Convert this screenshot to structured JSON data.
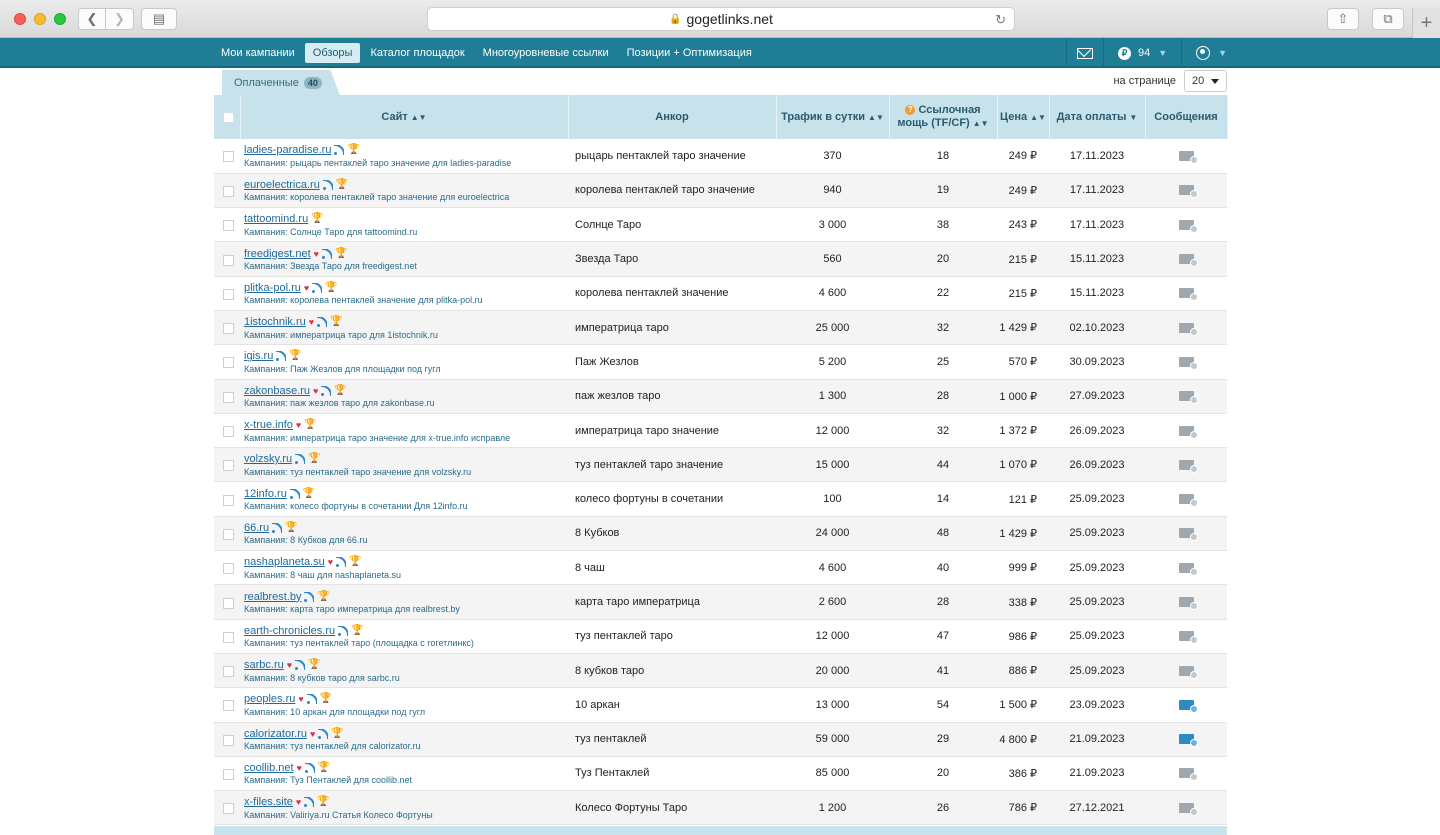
{
  "browser": {
    "url": "gogetlinks.net"
  },
  "nav": {
    "items": [
      "Мои кампании",
      "Обзоры",
      "Каталог площадок",
      "Многоуровневые ссылки",
      "Позиции + Оптимизация"
    ],
    "active_index": 1,
    "balance": "94",
    "currency_symbol": "₽"
  },
  "tabs": {
    "paid_label": "Оплаченные",
    "paid_count": "40"
  },
  "per_page": {
    "label": "на странице",
    "value": "20"
  },
  "table": {
    "headers": {
      "site": "Сайт",
      "anchor": "Анкор",
      "traffic": "Трафик в сутки",
      "power_line1": "Ссылочная",
      "power_line2": "мощь (TF/CF)",
      "price": "Цена",
      "date": "Дата оплаты",
      "messages": "Сообщения"
    },
    "rows": [
      {
        "site": "ladies-paradise.ru",
        "heart": false,
        "campaign": "Кампания: рыцарь пентаклей таро значение для ladies-paradise",
        "anchor": "рыцарь пентаклей таро значение",
        "traffic": "370",
        "power": "18",
        "price": "249 ₽",
        "date": "17.11.2023",
        "new_msg": false
      },
      {
        "site": "euroelectrica.ru",
        "heart": false,
        "campaign": "Кампания: королева пентаклей таро значение для euroelectrica",
        "anchor": "королева пентаклей таро значение",
        "traffic": "940",
        "power": "19",
        "price": "249 ₽",
        "date": "17.11.2023",
        "new_msg": false
      },
      {
        "site": "tattoomind.ru",
        "heart": false,
        "rss": false,
        "campaign": "Кампания: Солнце Таро для tattoomind.ru",
        "anchor": "Солнце Таро",
        "traffic": "3 000",
        "power": "38",
        "price": "243 ₽",
        "date": "17.11.2023",
        "new_msg": false
      },
      {
        "site": "freedigest.net",
        "heart": true,
        "campaign": "Кампания: Звезда Таро для freedigest.net",
        "anchor": "Звезда Таро",
        "traffic": "560",
        "power": "20",
        "price": "215 ₽",
        "date": "15.11.2023",
        "new_msg": false
      },
      {
        "site": "plitka-pol.ru",
        "heart": true,
        "campaign": "Кампания: королева пентаклей значение для plitka-pol.ru",
        "anchor": "королева пентаклей значение",
        "traffic": "4 600",
        "power": "22",
        "price": "215 ₽",
        "date": "15.11.2023",
        "new_msg": false
      },
      {
        "site": "1istochnik.ru",
        "heart": true,
        "campaign": "Кампания: императрица таро для 1istochnik.ru",
        "anchor": "императрица таро",
        "traffic": "25 000",
        "power": "32",
        "price": "1 429 ₽",
        "date": "02.10.2023",
        "new_msg": false
      },
      {
        "site": "igis.ru",
        "heart": false,
        "campaign": "Кампания: Паж Жезлов для площадки под гугл",
        "anchor": "Паж Жезлов",
        "traffic": "5 200",
        "power": "25",
        "price": "570 ₽",
        "date": "30.09.2023",
        "new_msg": false
      },
      {
        "site": "zakonbase.ru",
        "heart": true,
        "campaign": "Кампания: паж жезлов таро для zakonbase.ru",
        "anchor": "паж жезлов таро",
        "traffic": "1 300",
        "power": "28",
        "price": "1 000 ₽",
        "date": "27.09.2023",
        "new_msg": false
      },
      {
        "site": "x-true.info",
        "heart": true,
        "rss": false,
        "campaign": "Кампания: императрица таро значение для x-true.info исправле",
        "anchor": "императрица таро значение",
        "traffic": "12 000",
        "power": "32",
        "price": "1 372 ₽",
        "date": "26.09.2023",
        "new_msg": false
      },
      {
        "site": "volzsky.ru",
        "heart": false,
        "campaign": "Кампания: туз пентаклей таро значение для volzsky.ru",
        "anchor": "туз пентаклей таро значение",
        "traffic": "15 000",
        "power": "44",
        "price": "1 070 ₽",
        "date": "26.09.2023",
        "new_msg": false
      },
      {
        "site": "12info.ru",
        "heart": false,
        "campaign": "Кампания: колесо фортуны в сочетании Для 12info.ru",
        "anchor": "колесо фортуны в сочетании",
        "traffic": "100",
        "power": "14",
        "price": "121 ₽",
        "date": "25.09.2023",
        "new_msg": false
      },
      {
        "site": "66.ru",
        "heart": false,
        "campaign": "Кампания: 8 Кубков для 66.ru",
        "anchor": "8 Кубков",
        "traffic": "24 000",
        "power": "48",
        "price": "1 429 ₽",
        "date": "25.09.2023",
        "new_msg": false
      },
      {
        "site": "nashaplaneta.su",
        "heart": true,
        "campaign": "Кампания: 8 чаш для nashaplaneta.su",
        "anchor": "8 чаш",
        "traffic": "4 600",
        "power": "40",
        "price": "999 ₽",
        "date": "25.09.2023",
        "new_msg": false
      },
      {
        "site": "realbrest.by",
        "heart": false,
        "campaign": "Кампания: карта таро императрица для realbrest.by",
        "anchor": "карта таро императрица",
        "traffic": "2 600",
        "power": "28",
        "price": "338 ₽",
        "date": "25.09.2023",
        "new_msg": false
      },
      {
        "site": "earth-chronicles.ru",
        "heart": false,
        "campaign": "Кампания: туз пентаклей таро (площадка с гогетлинкс)",
        "anchor": "туз пентаклей таро",
        "traffic": "12 000",
        "power": "47",
        "price": "986 ₽",
        "date": "25.09.2023",
        "new_msg": false
      },
      {
        "site": "sarbc.ru",
        "heart": true,
        "campaign": "Кампания: 8 кубков таро для sarbc.ru",
        "anchor": "8 кубков таро",
        "traffic": "20 000",
        "power": "41",
        "price": "886 ₽",
        "date": "25.09.2023",
        "new_msg": false
      },
      {
        "site": "peoples.ru",
        "heart": true,
        "campaign": "Кампания: 10 аркан для площадки под гугл",
        "anchor": "10 аркан",
        "traffic": "13 000",
        "power": "54",
        "price": "1 500 ₽",
        "date": "23.09.2023",
        "new_msg": true
      },
      {
        "site": "calorizator.ru",
        "heart": true,
        "campaign": "Кампания: туз пентаклей для calorizator.ru",
        "anchor": "туз пентаклей",
        "traffic": "59 000",
        "power": "29",
        "price": "4 800 ₽",
        "date": "21.09.2023",
        "new_msg": true
      },
      {
        "site": "coollib.net",
        "heart": true,
        "campaign": "Кампания: Туз Пентаклей для coollib.net",
        "anchor": "Туз Пентаклей",
        "traffic": "85 000",
        "power": "20",
        "price": "386 ₽",
        "date": "21.09.2023",
        "new_msg": false
      },
      {
        "site": "x-files.site",
        "heart": true,
        "campaign": "Кампания: Valiriya.ru Статья Колесо Фортуны",
        "anchor": "Колесо Фортуны Таро",
        "traffic": "1 200",
        "power": "26",
        "price": "786 ₽",
        "date": "27.12.2021",
        "new_msg": false
      }
    ]
  },
  "colors": {
    "nav_bg": "#1f7d96",
    "header_bg": "#c7e2ea",
    "link": "#1f6a9a"
  }
}
